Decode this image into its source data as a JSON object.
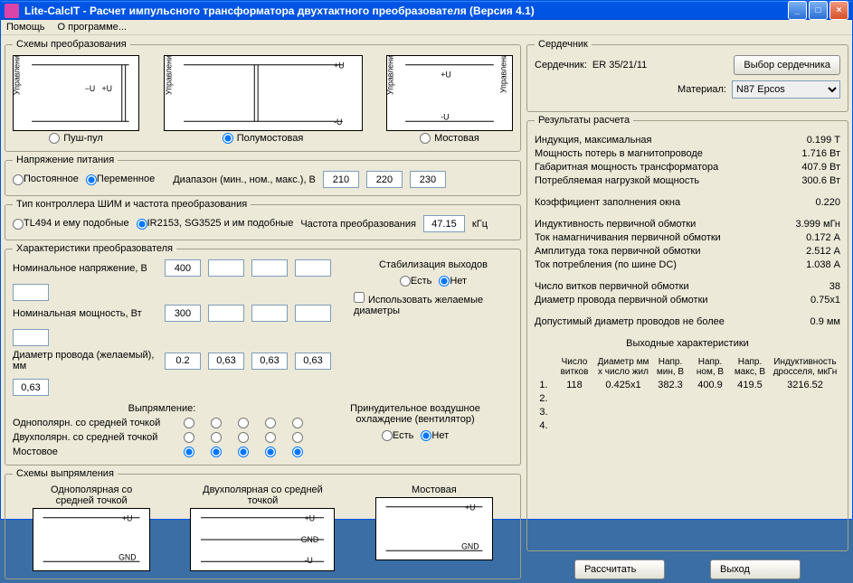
{
  "window": {
    "title": "Lite-CalcIT - Расчет импульсного трансформатора двухтактного преобразователя (Версия 4.1)"
  },
  "menu": {
    "help": "Помощь",
    "about": "О программе..."
  },
  "schemes": {
    "legend": "Схемы преобразования",
    "opt1": "Пуш-пул",
    "opt2": "Полумостовая",
    "opt3": "Мостовая",
    "selected": "opt2"
  },
  "supply": {
    "legend": "Напряжение питания",
    "opt_const": "Постоянное",
    "opt_var": "Переменное",
    "range_label": "Диапазон (мин., ном., макс.), В",
    "v_min": "210",
    "v_nom": "220",
    "v_max": "230"
  },
  "ctrl": {
    "legend": "Тип контроллера ШИМ и частота преобразования",
    "opt1": "TL494 и ему подобные",
    "opt2": "IR2153, SG3525 и им подобные",
    "freq_label": "Частота преобразования",
    "freq_val": "47.15",
    "freq_unit": "кГц"
  },
  "conv": {
    "legend": "Характеристики преобразователя",
    "volt_label": "Номинальное напряжение, В",
    "pow_label": "Номинальная мощность, Вт",
    "wire_label": "Диаметр провода (желаемый), мм",
    "v1": "400",
    "p1": "300",
    "d1": "0.2",
    "d2": "0,63",
    "d3": "0,63",
    "d4": "0,63",
    "d5": "0,63",
    "stab_label": "Стабилизация выходов",
    "yes": "Есть",
    "no": "Нет",
    "use_desired": "Использовать желаемые диаметры",
    "rect_label": "Выпрямление:",
    "rect1": "Однополярн. со средней точкой",
    "rect2": "Двухполярн. со средней точкой",
    "rect3": "Мостовое",
    "fan_label": "Принудительное воздушное охлаждение (вентилятор)"
  },
  "rect_schemes": {
    "legend": "Схемы выпрямления",
    "s1": "Однополярная со средней точкой",
    "s2": "Двухполярная со средней точкой",
    "s3": "Мостовая"
  },
  "core": {
    "legend": "Сердечник",
    "core_label": "Сердечник:",
    "core_val": "ER 35/21/11",
    "btn_select": "Выбор сердечника",
    "mat_label": "Материал:",
    "mat_val": "N87 Epcos"
  },
  "results": {
    "legend": "Результаты расчета",
    "rows": [
      {
        "label": "Индукция, максимальная",
        "val": "0.199 Т"
      },
      {
        "label": "Мощность потерь в магнитопроводе",
        "val": "1.716 Вт"
      },
      {
        "label": "Габаритная мощность трансформатора",
        "val": "407.9 Вт"
      },
      {
        "label": "Потребляемая нагрузкой мощность",
        "val": "300.6 Вт"
      }
    ],
    "rows2": [
      {
        "label": "Коэффициент заполнения окна",
        "val": "0.220"
      }
    ],
    "rows3": [
      {
        "label": "Индуктивность первичной обмотки",
        "val": "3.999 мГн"
      },
      {
        "label": "Ток намагничивания первичной обмотки",
        "val": "0.172 А"
      },
      {
        "label": "Амплитуда тока первичной обмотки",
        "val": "2.512 А"
      },
      {
        "label": "Ток потребления (по шине DC)",
        "val": "1.038 А"
      }
    ],
    "rows4": [
      {
        "label": "Число витков первичной обмотки",
        "val": "38"
      },
      {
        "label": "Диаметр провода первичной обмотки",
        "val": "0.75x1"
      }
    ],
    "rows5": [
      {
        "label": "Допустимый диаметр проводов не более",
        "val": "0.9 мм"
      }
    ],
    "out_title": "Выходные характеристики",
    "out_headers": [
      "",
      "Число витков",
      "Диаметр мм х число жил",
      "Напр. мин, В",
      "Напр. ном, В",
      "Напр. макс, В",
      "Индуктивность дросселя, мкГн"
    ],
    "out_rows": [
      {
        "n": "1.",
        "turns": "118",
        "dia": "0.425x1",
        "vmin": "382.3",
        "vnom": "400.9",
        "vmax": "419.5",
        "ind": "3216.52"
      },
      {
        "n": "2.",
        "turns": "",
        "dia": "",
        "vmin": "",
        "vnom": "",
        "vmax": "",
        "ind": ""
      },
      {
        "n": "3.",
        "turns": "",
        "dia": "",
        "vmin": "",
        "vnom": "",
        "vmax": "",
        "ind": ""
      },
      {
        "n": "4.",
        "turns": "",
        "dia": "",
        "vmin": "",
        "vnom": "",
        "vmax": "",
        "ind": ""
      }
    ]
  },
  "btns": {
    "calc": "Рассчитать",
    "exit": "Выход"
  },
  "svg_labels": {
    "ctrl": "Управление",
    "u_plus": "+U",
    "u_minus": "-U",
    "gnd": "GND"
  }
}
